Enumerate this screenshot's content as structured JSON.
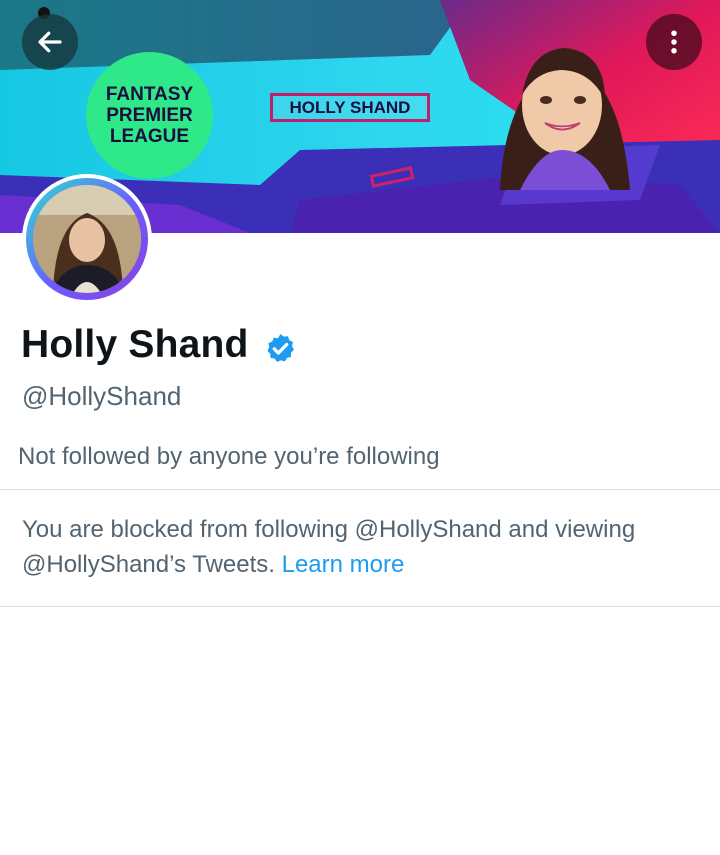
{
  "banner": {
    "badge_text": "FANTASY\nPREMIER\nLEAGUE",
    "name_box_text": "HOLLY SHAND"
  },
  "header": {
    "back_icon": "arrow-left-icon",
    "more_icon": "more-vertical-icon"
  },
  "profile": {
    "display_name": "Holly Shand",
    "verified_icon": "verified-badge-icon",
    "handle": "@HollyShand",
    "followed_by": "Not followed by anyone you’re following",
    "blocked_message": "You are blocked from following @HollyShand and viewing @HollyShand’s Tweets.",
    "learn_more": "Learn more"
  },
  "colors": {
    "accent": "#1d9bf0",
    "secondary_text": "#536471",
    "primary_text": "#0f1419",
    "divider": "#d8dee3"
  }
}
